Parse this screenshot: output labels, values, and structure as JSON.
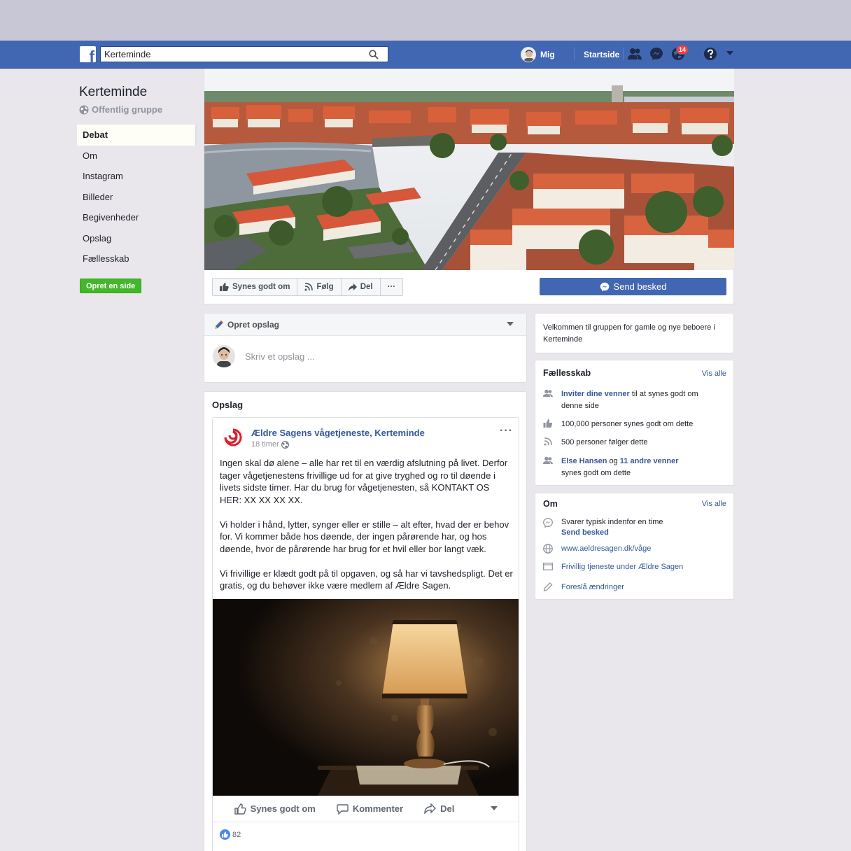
{
  "header": {
    "search_value": "Kerteminde",
    "profile_name": "Mig",
    "home_label": "Startside",
    "notification_count": "14"
  },
  "group": {
    "name": "Kerteminde",
    "type": "Offentlig gruppe",
    "nav": [
      {
        "label": "Debat",
        "active": true
      },
      {
        "label": "Om"
      },
      {
        "label": "Instagram"
      },
      {
        "label": "Billeder"
      },
      {
        "label": "Begivenheder"
      },
      {
        "label": "Opslag"
      },
      {
        "label": "Fællesskab"
      }
    ],
    "create_page_label": "Opret en side"
  },
  "cover_actions": {
    "like": "Synes godt om",
    "follow": "Følg",
    "share": "Del",
    "more": "···",
    "send_message": "Send besked"
  },
  "composer": {
    "title": "Opret opslag",
    "placeholder": "Skriv et opslag ..."
  },
  "feed": {
    "title": "Opslag",
    "post": {
      "author": "Ældre Sagens vågetjeneste, Kerteminde",
      "time": "18 timer",
      "paragraph_1": "Ingen skal dø alene – alle har ret til en værdig afslutning på livet. Derfor tager vågetjenestens frivillige ud for at give tryghed og ro til døende i livets sidste timer. Har du brug for vågetjenesten, så KONTAKT OS HER: XX XX XX XX.",
      "paragraph_2": "Vi holder i hånd, lytter, synger eller er stille – alt efter, hvad der er behov for. Vi kommer både hos døende, der ingen pårørende har, og hos døende, hvor de pårørende har brug for et hvil eller bor langt væk.",
      "paragraph_3": "Vi frivillige er klædt godt på til opgaven, og så har vi tavshedspligt. Det er gratis, og du behøver ikke være medlem af Ældre Sagen.",
      "action_like": "Synes godt om",
      "action_comment": "Kommenter",
      "action_share": "Del",
      "likes_count": "82"
    }
  },
  "sidebar": {
    "welcome": "Velkommen til gruppen for gamle og nye beboere i Kerteminde",
    "community": {
      "title": "Fællesskab",
      "see_all": "Vis alle",
      "invite_link": "Inviter dine venner",
      "invite_rest": " til at synes godt om denne side",
      "likes": "100,000 personer synes godt om dette",
      "follows": "500 personer følger dette",
      "friend_name": "Else Hansen",
      "friend_and": " og ",
      "friend_others": "11 andre venner",
      "friend_rest": " synes godt om dette"
    },
    "about": {
      "title": "Om",
      "see_all": "Vis alle",
      "response": "Svarer typisk indenfor en time",
      "send_message": "Send besked",
      "website": "www.aeldresagen.dk/våge",
      "category": "Frivillig tjeneste under Ældre Sagen",
      "suggest": "Foreslå ændringer"
    }
  },
  "colors": {
    "brand_blue": "#4267b2",
    "link_blue": "#365899",
    "green_button": "#42b72a",
    "badge_red": "#fa3e3e"
  }
}
